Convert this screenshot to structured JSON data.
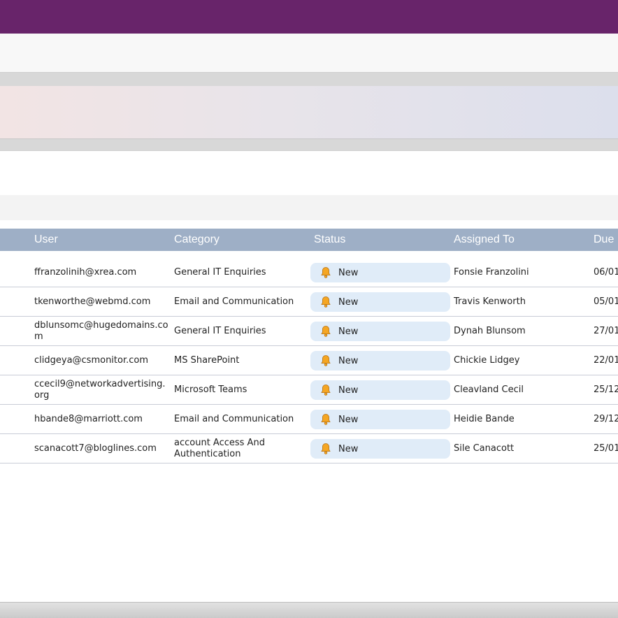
{
  "theme": {
    "header_color": "#68246a",
    "grid_header_color": "#9eafc6",
    "status_pill_color": "#e0ecf8",
    "bell_icon_color": "#f5a623"
  },
  "grid": {
    "columns": [
      "User",
      "Category",
      "Status",
      "Assigned To",
      "Due"
    ],
    "rows": [
      {
        "user": "ffranzolinih@xrea.com",
        "category": "General IT Enquiries",
        "status": "New",
        "assigned_to": "Fonsie Franzolini",
        "due": "06/01"
      },
      {
        "user": "tkenworthe@webmd.com",
        "category": "Email and Communication",
        "status": "New",
        "assigned_to": "Travis Kenworth",
        "due": "05/01"
      },
      {
        "user": "dblunsomc@hugedomains.com",
        "category": "General IT Enquiries",
        "status": "New",
        "assigned_to": "Dynah Blunsom",
        "due": "27/01"
      },
      {
        "user": "clidgeya@csmonitor.com",
        "category": "MS SharePoint",
        "status": "New",
        "assigned_to": "Chickie Lidgey",
        "due": "22/01"
      },
      {
        "user": "ccecil9@networkadvertising.org",
        "category": "Microsoft Teams",
        "status": "New",
        "assigned_to": "Cleavland Cecil",
        "due": "25/12"
      },
      {
        "user": "hbande8@marriott.com",
        "category": "Email and Communication",
        "status": "New",
        "assigned_to": "Heidie Bande",
        "due": "29/12"
      },
      {
        "user": "scanacott7@bloglines.com",
        "category": "account Access And Authentication",
        "status": "New",
        "assigned_to": "Sile Canacott",
        "due": "25/01"
      }
    ]
  }
}
